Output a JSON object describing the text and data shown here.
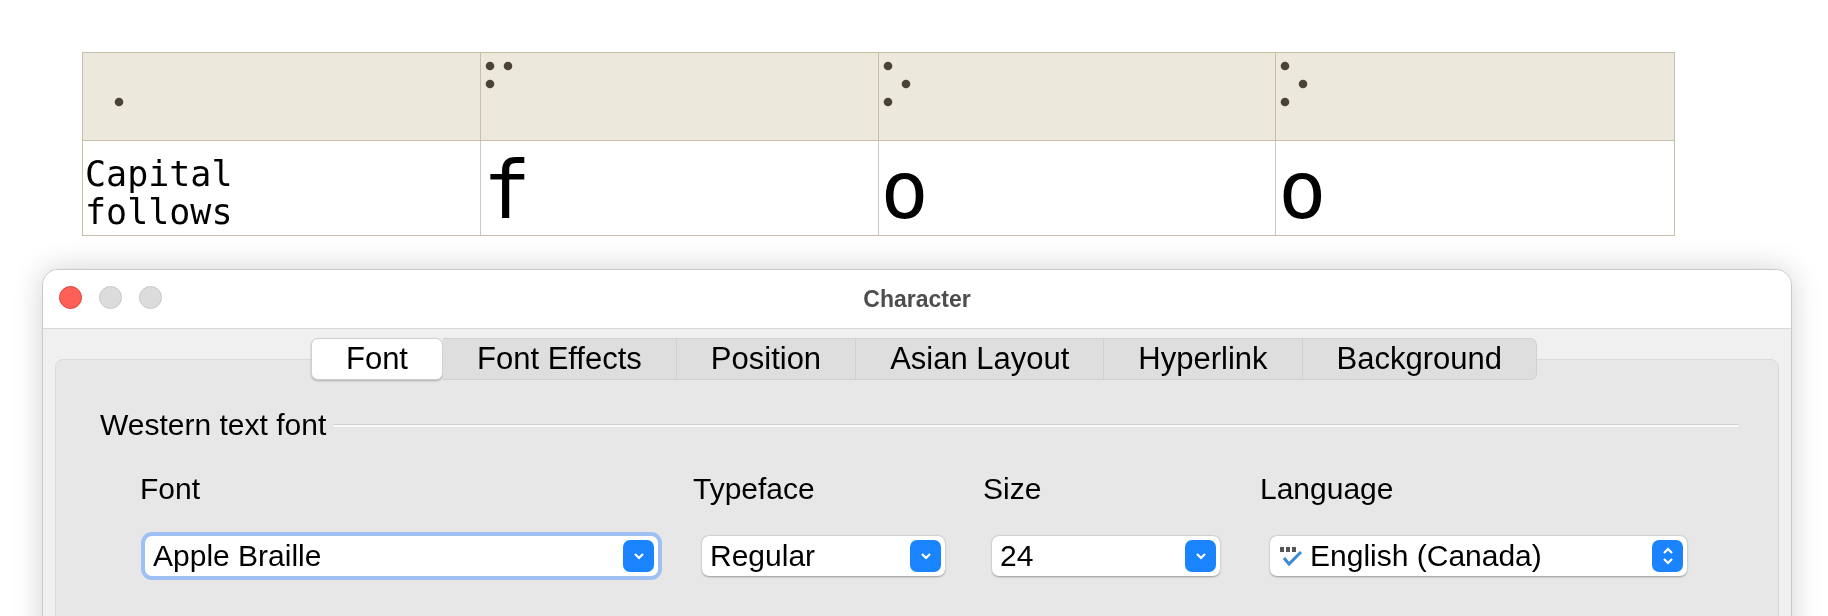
{
  "table": {
    "braille_row": [
      {
        "dots": [
          {
            "raised": false
          },
          {
            "raised": false
          },
          {
            "raised": false
          },
          {
            "raised": false
          },
          {
            "raised": false
          },
          {
            "raised": true
          }
        ]
      },
      {
        "dots": [
          {
            "raised": true
          },
          {
            "raised": true
          },
          {
            "raised": false
          },
          {
            "raised": true
          },
          {
            "raised": false
          },
          {
            "raised": false
          }
        ]
      },
      {
        "dots": [
          {
            "raised": true
          },
          {
            "raised": false
          },
          {
            "raised": true
          },
          {
            "raised": false
          },
          {
            "raised": true
          },
          {
            "raised": false
          }
        ]
      },
      {
        "dots": [
          {
            "raised": true
          },
          {
            "raised": false
          },
          {
            "raised": true
          },
          {
            "raised": false
          },
          {
            "raised": true
          },
          {
            "raised": false
          }
        ]
      }
    ],
    "text_row": [
      {
        "text": "Capital follows",
        "kind": "label"
      },
      {
        "text": "f",
        "kind": "glyph"
      },
      {
        "text": "o",
        "kind": "glyph"
      },
      {
        "text": "o",
        "kind": "glyph"
      }
    ]
  },
  "window": {
    "title": "Character",
    "tabs": [
      {
        "label": "Font",
        "selected": true
      },
      {
        "label": "Font Effects",
        "selected": false
      },
      {
        "label": "Position",
        "selected": false
      },
      {
        "label": "Asian Layout",
        "selected": false
      },
      {
        "label": "Hyperlink",
        "selected": false
      },
      {
        "label": "Background",
        "selected": false
      }
    ],
    "section": "Western text font",
    "fields": [
      {
        "label": "Font",
        "value": "Apple Braille",
        "kind": "popup",
        "focused": true
      },
      {
        "label": "Typeface",
        "value": "Regular",
        "kind": "popup",
        "focused": false
      },
      {
        "label": "Size",
        "value": "24",
        "kind": "popup",
        "focused": false
      },
      {
        "label": "Language",
        "value": "English (Canada)",
        "kind": "stepper",
        "focused": false
      }
    ]
  }
}
